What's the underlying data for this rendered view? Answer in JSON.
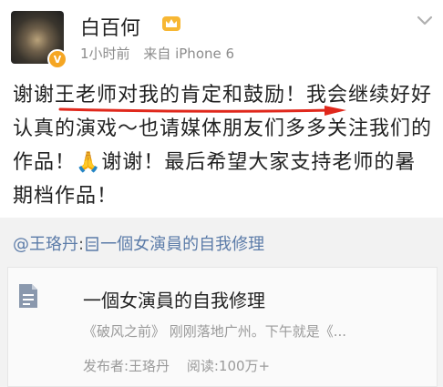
{
  "post": {
    "username": "白百何",
    "time": "1小时前",
    "source": "来自 iPhone 6",
    "text_part1": "谢谢王老师对我的肯定和鼓励！我会继续好好认真的演戏～也请媒体朋友们多多关注我们的作品！",
    "text_emoji": "🙏",
    "text_part2": "谢谢！最后希望大家支持老师的暑期档作品！"
  },
  "repost": {
    "author": "@王珞丹",
    "author_rest": ":",
    "article_label": "一個女演員的自我修理",
    "card": {
      "title": "一個女演員的自我修理",
      "excerpt": "《破风之前》 刚刚落地广州。下午就是《...",
      "publisher": "发布者:王珞丹",
      "reads": "阅读:100万+"
    }
  },
  "colors": {
    "link": "#5b7ba8",
    "verified": "#f5a623",
    "underline": "#e0281c"
  },
  "icons": [
    "crown-icon",
    "verified-badge-icon",
    "chevron-down-icon",
    "document-icon",
    "pray-emoji-icon",
    "article-icon"
  ]
}
